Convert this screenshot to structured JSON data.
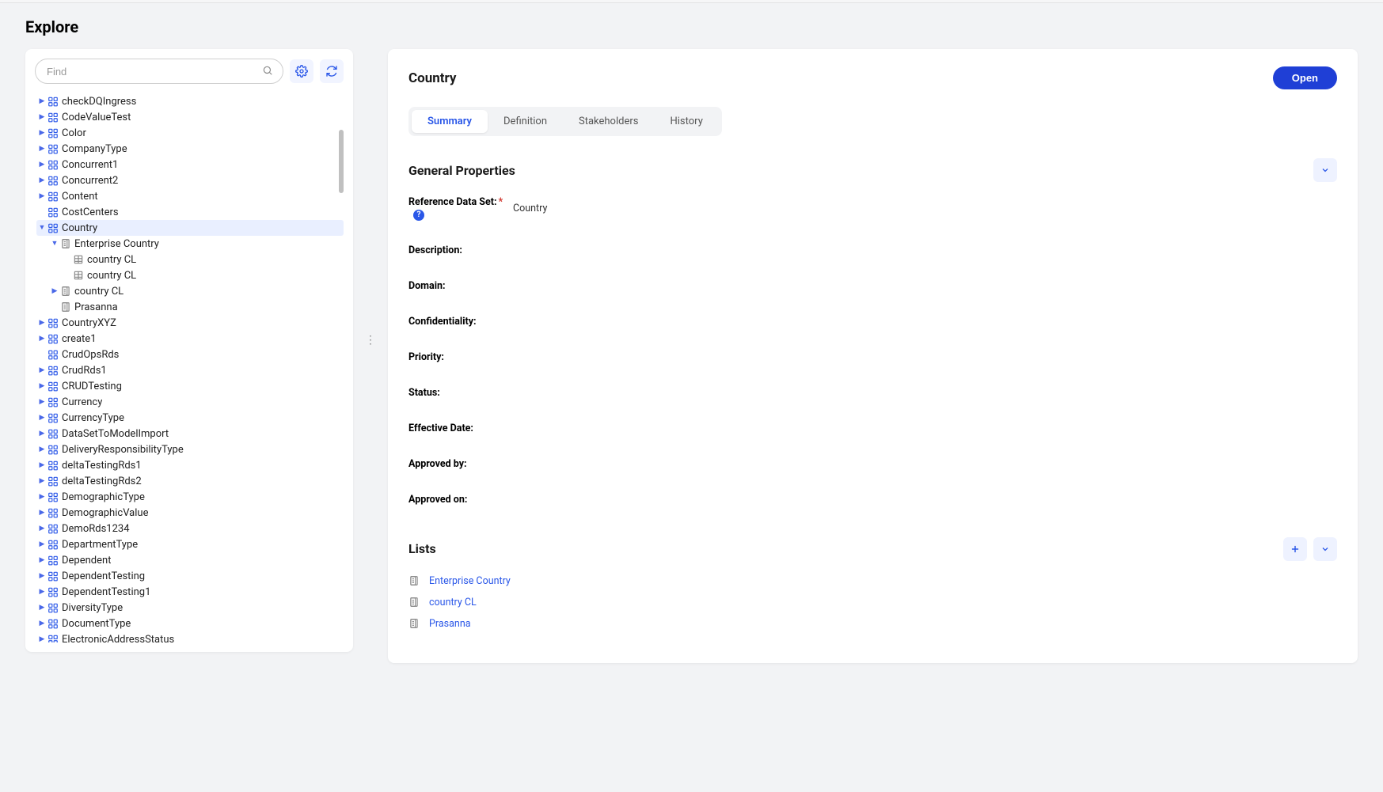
{
  "page_title": "Explore",
  "search": {
    "placeholder": "Find",
    "value": ""
  },
  "tree": {
    "items": [
      {
        "depth": 0,
        "arrow": "right",
        "icon": "rds",
        "label": "checkDQIngress",
        "selected": false
      },
      {
        "depth": 0,
        "arrow": "right",
        "icon": "rds",
        "label": "CodeValueTest",
        "selected": false
      },
      {
        "depth": 0,
        "arrow": "right",
        "icon": "rds",
        "label": "Color",
        "selected": false
      },
      {
        "depth": 0,
        "arrow": "right",
        "icon": "rds",
        "label": "CompanyType",
        "selected": false
      },
      {
        "depth": 0,
        "arrow": "right",
        "icon": "rds",
        "label": "Concurrent1",
        "selected": false
      },
      {
        "depth": 0,
        "arrow": "right",
        "icon": "rds",
        "label": "Concurrent2",
        "selected": false
      },
      {
        "depth": 0,
        "arrow": "right",
        "icon": "rds",
        "label": "Content",
        "selected": false
      },
      {
        "depth": 0,
        "arrow": "none",
        "icon": "rds",
        "label": "CostCenters",
        "selected": false
      },
      {
        "depth": 0,
        "arrow": "down",
        "icon": "rds",
        "label": "Country",
        "selected": true
      },
      {
        "depth": 1,
        "arrow": "down",
        "icon": "list",
        "label": "Enterprise Country",
        "selected": false
      },
      {
        "depth": 2,
        "arrow": "none",
        "icon": "cl",
        "label": "country CL",
        "selected": false
      },
      {
        "depth": 2,
        "arrow": "none",
        "icon": "cl",
        "label": "country CL",
        "selected": false
      },
      {
        "depth": 1,
        "arrow": "right",
        "icon": "list",
        "label": "country CL",
        "selected": false
      },
      {
        "depth": 1,
        "arrow": "none",
        "icon": "list",
        "label": "Prasanna",
        "selected": false
      },
      {
        "depth": 0,
        "arrow": "right",
        "icon": "rds",
        "label": "CountryXYZ",
        "selected": false
      },
      {
        "depth": 0,
        "arrow": "right",
        "icon": "rds",
        "label": "create1",
        "selected": false
      },
      {
        "depth": 0,
        "arrow": "none",
        "icon": "rds",
        "label": "CrudOpsRds",
        "selected": false
      },
      {
        "depth": 0,
        "arrow": "right",
        "icon": "rds",
        "label": "CrudRds1",
        "selected": false
      },
      {
        "depth": 0,
        "arrow": "right",
        "icon": "rds",
        "label": "CRUDTesting",
        "selected": false
      },
      {
        "depth": 0,
        "arrow": "right",
        "icon": "rds",
        "label": "Currency",
        "selected": false
      },
      {
        "depth": 0,
        "arrow": "right",
        "icon": "rds",
        "label": "CurrencyType",
        "selected": false
      },
      {
        "depth": 0,
        "arrow": "right",
        "icon": "rds",
        "label": "DataSetToModelImport",
        "selected": false
      },
      {
        "depth": 0,
        "arrow": "right",
        "icon": "rds",
        "label": "DeliveryResponsibilityType",
        "selected": false
      },
      {
        "depth": 0,
        "arrow": "right",
        "icon": "rds",
        "label": "deltaTestingRds1",
        "selected": false
      },
      {
        "depth": 0,
        "arrow": "right",
        "icon": "rds",
        "label": "deltaTestingRds2",
        "selected": false
      },
      {
        "depth": 0,
        "arrow": "right",
        "icon": "rds",
        "label": "DemographicType",
        "selected": false
      },
      {
        "depth": 0,
        "arrow": "right",
        "icon": "rds",
        "label": "DemographicValue",
        "selected": false
      },
      {
        "depth": 0,
        "arrow": "right",
        "icon": "rds",
        "label": "DemoRds1234",
        "selected": false
      },
      {
        "depth": 0,
        "arrow": "right",
        "icon": "rds",
        "label": "DepartmentType",
        "selected": false
      },
      {
        "depth": 0,
        "arrow": "right",
        "icon": "rds",
        "label": "Dependent",
        "selected": false
      },
      {
        "depth": 0,
        "arrow": "right",
        "icon": "rds",
        "label": "DependentTesting",
        "selected": false
      },
      {
        "depth": 0,
        "arrow": "right",
        "icon": "rds",
        "label": "DependentTesting1",
        "selected": false
      },
      {
        "depth": 0,
        "arrow": "right",
        "icon": "rds",
        "label": "DiversityType",
        "selected": false
      },
      {
        "depth": 0,
        "arrow": "right",
        "icon": "rds",
        "label": "DocumentType",
        "selected": false
      },
      {
        "depth": 0,
        "arrow": "right",
        "icon": "rds",
        "label": "ElectronicAddressStatus",
        "selected": false
      }
    ]
  },
  "detail": {
    "title": "Country",
    "open_label": "Open",
    "tabs": [
      {
        "label": "Summary",
        "active": true
      },
      {
        "label": "Definition",
        "active": false
      },
      {
        "label": "Stakeholders",
        "active": false
      },
      {
        "label": "History",
        "active": false
      }
    ],
    "section_general_title": "General Properties",
    "properties": {
      "reference_data_set": {
        "label": "Reference Data Set:",
        "required": true,
        "help": true,
        "value": "Country"
      },
      "description": {
        "label": "Description:",
        "value": ""
      },
      "domain": {
        "label": "Domain:",
        "value": ""
      },
      "confidentiality": {
        "label": "Confidentiality:",
        "value": ""
      },
      "priority": {
        "label": "Priority:",
        "value": ""
      },
      "status": {
        "label": "Status:",
        "value": ""
      },
      "effective_date": {
        "label": "Effective Date:",
        "value": ""
      },
      "approved_by": {
        "label": "Approved by:",
        "value": ""
      },
      "approved_on": {
        "label": "Approved on:",
        "value": ""
      }
    },
    "section_lists_title": "Lists",
    "lists": [
      {
        "label": "Enterprise Country"
      },
      {
        "label": "country CL"
      },
      {
        "label": "Prasanna"
      }
    ]
  }
}
